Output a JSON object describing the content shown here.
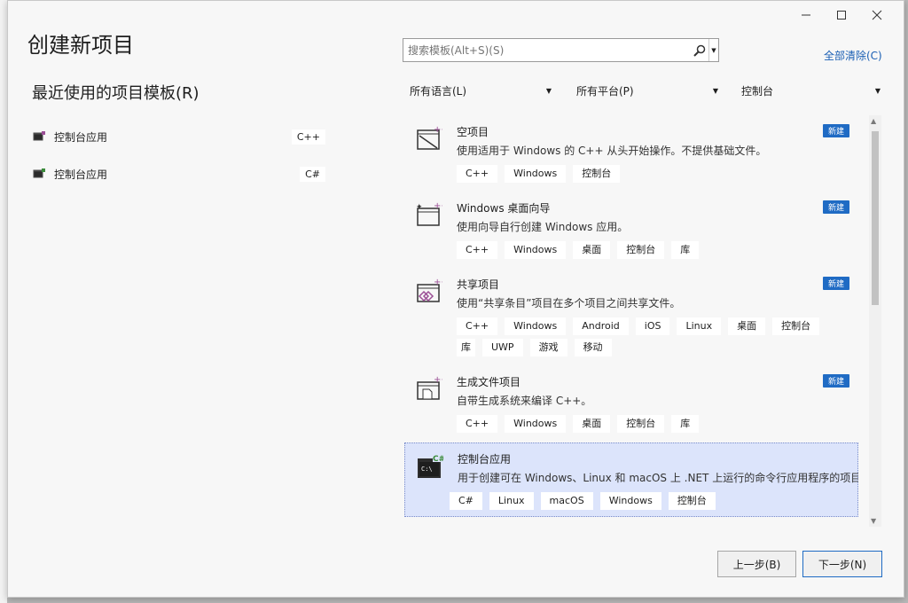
{
  "window": {
    "title": "创建新项目",
    "recent_title": "最近使用的项目模板(R)"
  },
  "recent": [
    {
      "label": "控制台应用",
      "lang": "C++"
    },
    {
      "label": "控制台应用",
      "lang": "C#"
    }
  ],
  "search": {
    "placeholder": "搜索模板(Alt+S)(S)"
  },
  "clear_all": "全部清除(C)",
  "filters": {
    "language": "所有语言(L)",
    "platform": "所有平台(P)",
    "type": "控制台"
  },
  "templates": [
    {
      "name": "空项目",
      "desc": "使用适用于 Windows 的 C++ 从头开始操作。不提供基础文件。",
      "badge": "新建",
      "tags_row1": [
        "C++",
        "Windows",
        "控制台"
      ],
      "tags_row2": []
    },
    {
      "name": "Windows 桌面向导",
      "desc": "使用向导自行创建 Windows 应用。",
      "badge": "新建",
      "tags_row1": [
        "C++",
        "Windows",
        "桌面",
        "控制台",
        "库"
      ],
      "tags_row2": []
    },
    {
      "name": "共享项目",
      "desc": "使用“共享条目”项目在多个项目之间共享文件。",
      "badge": "新建",
      "tags_row1": [
        "C++",
        "Windows",
        "Android",
        "iOS",
        "Linux",
        "桌面",
        "控制台"
      ],
      "tags_row2": [
        "库",
        "UWP",
        "游戏",
        "移动"
      ]
    },
    {
      "name": "生成文件项目",
      "desc": "自带生成系统来编译 C++。",
      "badge": "新建",
      "tags_row1": [
        "C++",
        "Windows",
        "桌面",
        "控制台",
        "库"
      ],
      "tags_row2": []
    },
    {
      "name": "控制台应用",
      "desc": "用于创建可在 Windows、Linux 和 macOS 上 .NET 上运行的命令行应用程序的项目",
      "badge": "",
      "tags_row1": [
        "C#",
        "Linux",
        "macOS",
        "Windows",
        "控制台"
      ],
      "tags_row2": []
    }
  ],
  "buttons": {
    "back": "上一步(B)",
    "next": "下一步(N)"
  },
  "colors": {
    "accent": "#1f6bc4",
    "selected": "#dce4fb"
  }
}
